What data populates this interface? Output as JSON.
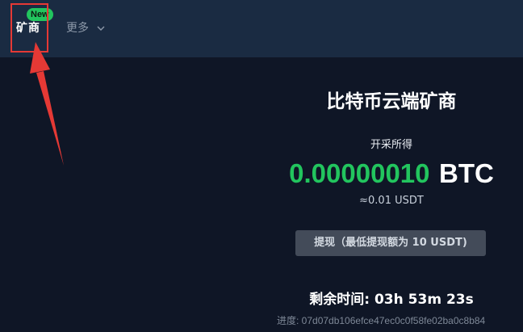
{
  "nav": {
    "miner_label": "矿商",
    "badge_label": "New",
    "more_label": "更多"
  },
  "main": {
    "title": "比特币云端矿商",
    "mined_label": "开采所得",
    "amount": "0.00000010",
    "unit": "BTC",
    "approx": "≈0.01 USDT",
    "withdraw_label": "提现（最低提现额为 10 USDT)",
    "countdown": "剩余时间: 03h 53m 23s",
    "progress_text": "进度: 07d07db106efce47ec0c0f58fe02ba0c8b84"
  },
  "colors": {
    "background": "#0f1626",
    "header": "#1a2b42",
    "accent_green": "#22c55e",
    "highlight_red": "#e53935",
    "button_bg": "#434b59"
  },
  "icons": {
    "more_chevron": "chevron-down-icon",
    "annotation_arrow": "red-arrow-icon"
  }
}
